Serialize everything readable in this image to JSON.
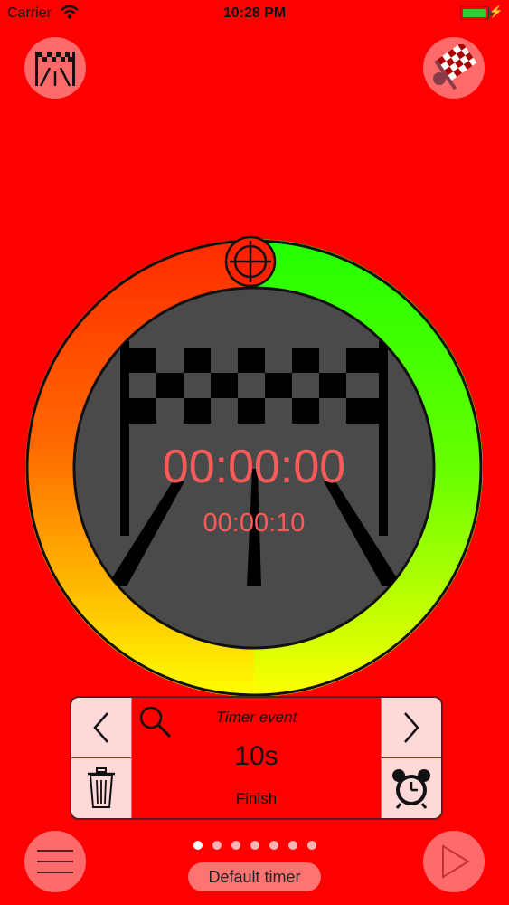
{
  "status_bar": {
    "carrier": "Carrier",
    "time": "10:28 PM"
  },
  "dial": {
    "elapsed": "00:00:00",
    "target": "00:00:10",
    "time_color": "#ff5a5a",
    "ring_colors": [
      "#ff3300",
      "#ffff00",
      "#33ff00"
    ]
  },
  "event_card": {
    "title": "Timer event",
    "value": "10s",
    "subtitle": "Finish"
  },
  "page_indicator": {
    "count": 7,
    "active_index": 0
  },
  "bottom": {
    "timer_label": "Default timer"
  },
  "icons": {
    "top_left": "finish-line-icon",
    "top_right": "checkered-flag-icon",
    "bottom_left": "menu-icon",
    "bottom_right": "play-icon",
    "card": [
      "chevron-left-icon",
      "search-icon",
      "chevron-right-icon",
      "trash-icon",
      "alarm-clock-icon"
    ]
  }
}
